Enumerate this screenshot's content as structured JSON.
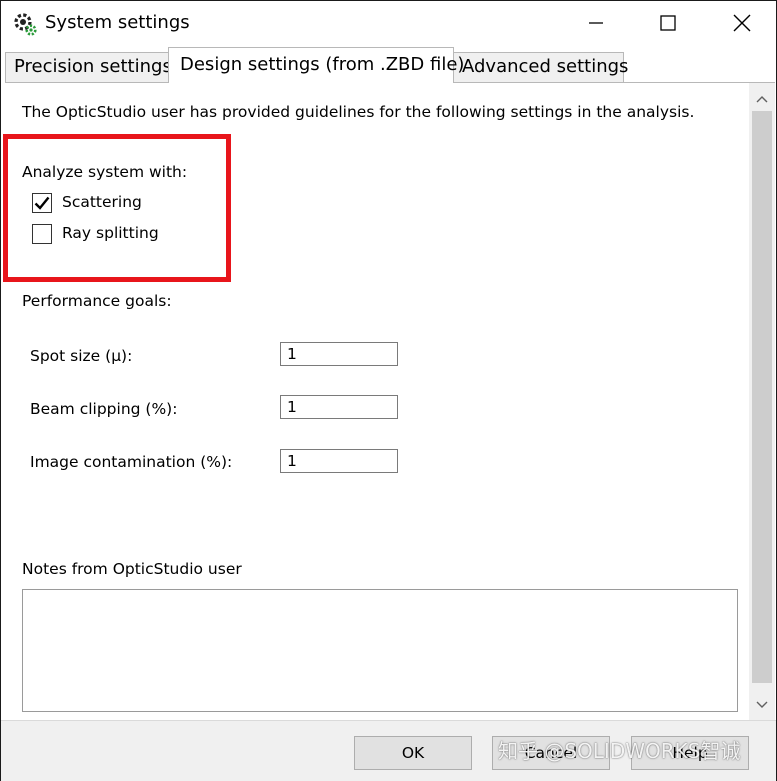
{
  "window": {
    "title": "System settings"
  },
  "tabs": [
    {
      "label": "Precision settings"
    },
    {
      "label": "Design settings (from .ZBD file)"
    },
    {
      "label": "Advanced settings"
    }
  ],
  "content": {
    "intro": "The OpticStudio user has provided guidelines for the following settings in the analysis.",
    "analyze_label": "Analyze system with:",
    "options": [
      {
        "label": "Scattering",
        "checked": true
      },
      {
        "label": "Ray splitting",
        "checked": false
      }
    ],
    "performance_label": "Performance goals:",
    "goals": [
      {
        "label": "Spot size (μ):",
        "value": "1"
      },
      {
        "label": "Beam clipping (%):",
        "value": "1"
      },
      {
        "label": "Image contamination (%):",
        "value": "1"
      }
    ],
    "notes_label": "Notes from OpticStudio user",
    "notes_value": ""
  },
  "footer": {
    "ok_label": "OK",
    "cancel_label": "Cancel",
    "help_label": "Help"
  },
  "watermark": "知乎 @SOLIDWORKS智诚",
  "colors": {
    "highlight": "#e8151b",
    "footer_bg": "#f0f0f0"
  },
  "icons": [
    "gear-icon",
    "minimize-icon",
    "maximize-icon",
    "close-icon",
    "checkmark-icon",
    "scroll-up-icon",
    "scroll-down-icon"
  ]
}
